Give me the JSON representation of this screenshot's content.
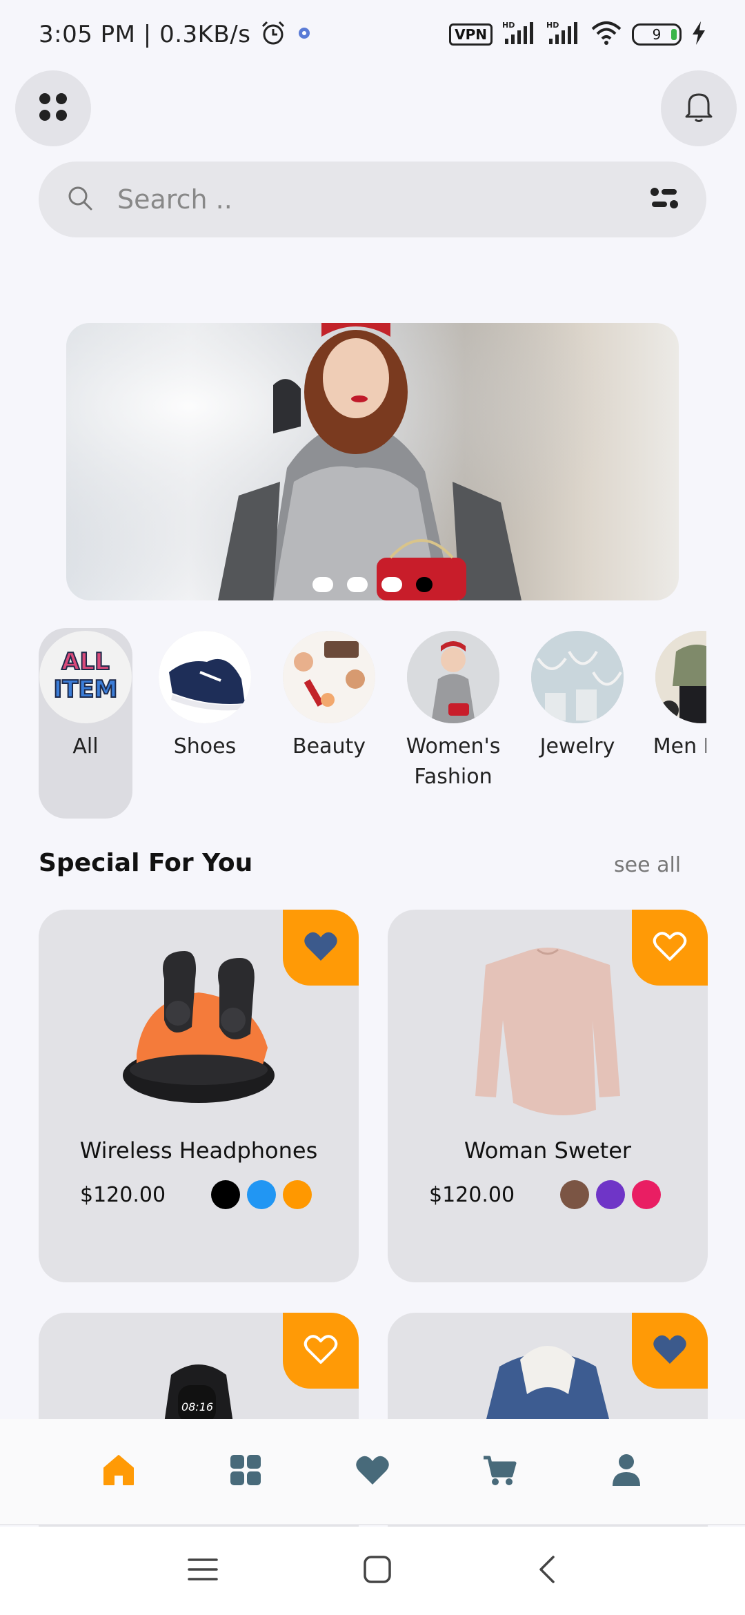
{
  "status_bar": {
    "time": "3:05 PM | 0.3KB/s",
    "vpn": "VPN",
    "battery": "9"
  },
  "search": {
    "placeholder": "Search .."
  },
  "banner": {
    "slide_count": 4,
    "active_index": 3
  },
  "categories": [
    {
      "label": "All",
      "active": true
    },
    {
      "label": "Shoes"
    },
    {
      "label": "Beauty"
    },
    {
      "label": "Women's Fashion"
    },
    {
      "label": "Jewelry"
    },
    {
      "label": "Men Fash"
    }
  ],
  "all_thumb_text": "ALL ITEM",
  "section": {
    "title": "Special For You",
    "see_all": "see all"
  },
  "products": [
    {
      "name": "Wireless Headphones",
      "price": "$120.00",
      "favorited": true,
      "colors": [
        "#000000",
        "#2196f3",
        "#ff9800"
      ]
    },
    {
      "name": "Woman Sweter",
      "price": "$120.00",
      "favorited": false,
      "colors": [
        "#7b5544",
        "#6f35c7",
        "#e91e63"
      ]
    },
    {
      "name": "",
      "price": "",
      "favorited": false,
      "colors": []
    },
    {
      "name": "",
      "price": "",
      "favorited": true,
      "colors": []
    }
  ],
  "colors": {
    "accent": "#ff9a06",
    "nav_icon": "#486a7a",
    "heart_fill": "#3c5a8c"
  },
  "bottom_nav": [
    "home-icon",
    "grid-icon",
    "heart-icon",
    "cart-icon",
    "profile-icon"
  ]
}
